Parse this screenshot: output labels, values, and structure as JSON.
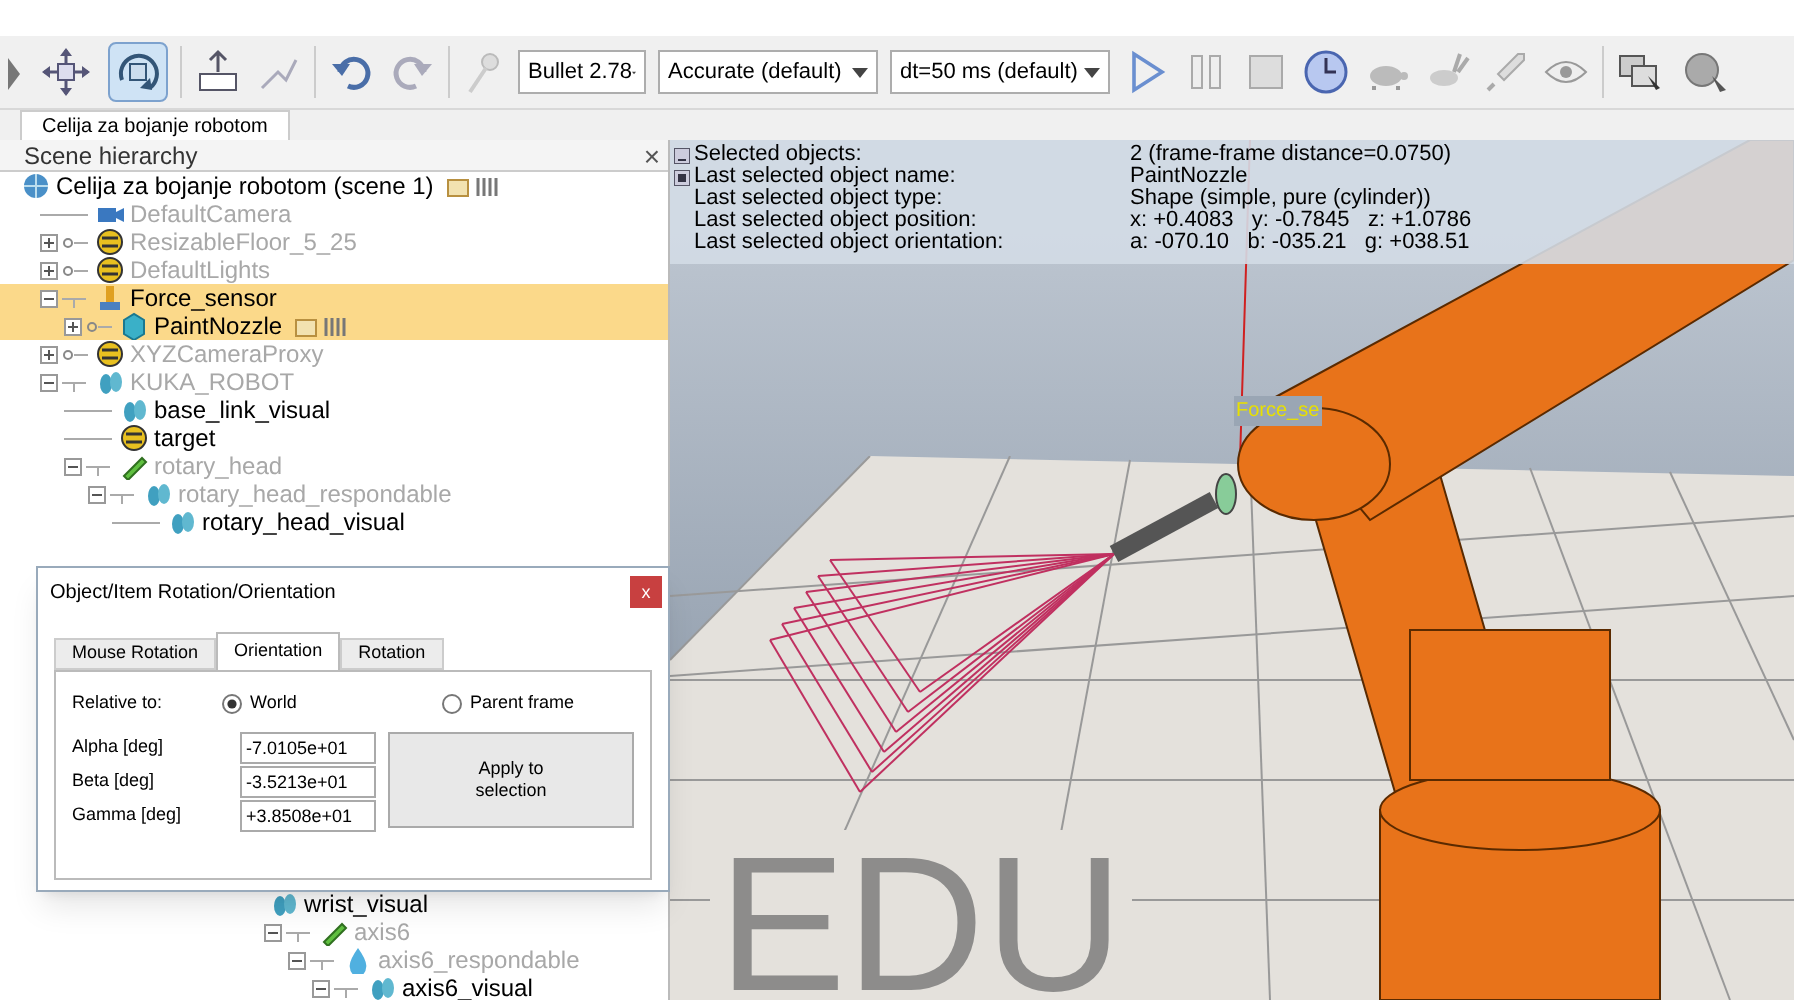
{
  "toolbar": {
    "mode_buttons": [
      {
        "kind": "move",
        "selected": false
      },
      {
        "kind": "rotate",
        "selected": true
      }
    ],
    "dropdowns": [
      {
        "value": "Bullet 2.78"
      },
      {
        "value": "Accurate (default)"
      },
      {
        "value": "dt=50 ms (default)"
      }
    ]
  },
  "scene_tabs": [
    {
      "label": "Celija za bojanje robotom",
      "selected": true
    }
  ],
  "hierarchy": {
    "title": "Scene hierarchy",
    "close": "×",
    "tree": [
      {
        "label": "Celija za bojanje robotom (scene 1)",
        "kind": "scene",
        "dim": false,
        "selected": false,
        "script": true,
        "children": [
          {
            "label": "DefaultCamera",
            "kind": "camera",
            "dim": true,
            "selected": false,
            "script": false
          },
          {
            "label": "ResizableFloor_5_25",
            "kind": "dummy",
            "dim": true,
            "selected": false,
            "script": false,
            "expanded": false
          },
          {
            "label": "DefaultLights",
            "kind": "dummy",
            "dim": true,
            "selected": false,
            "script": false,
            "expanded": false
          },
          {
            "label": "Force_sensor",
            "kind": "sensor",
            "dim": false,
            "selected": true,
            "script": false,
            "expanded": true,
            "children": [
              {
                "label": "PaintNozzle",
                "kind": "shape",
                "dim": false,
                "selected": true,
                "script": true,
                "expanded": false
              }
            ]
          },
          {
            "label": "XYZCameraProxy",
            "kind": "dummy",
            "dim": true,
            "selected": false,
            "script": false,
            "expanded": false
          },
          {
            "label": "KUKA_ROBOT",
            "kind": "mesh",
            "dim": true,
            "selected": false,
            "script": false,
            "expanded": true,
            "children": [
              {
                "label": "base_link_visual",
                "kind": "mesh",
                "dim": false,
                "selected": false,
                "script": false
              },
              {
                "label": "target",
                "kind": "dummy",
                "dim": false,
                "selected": false,
                "script": false
              },
              {
                "label": "rotary_head",
                "kind": "joint",
                "dim": true,
                "selected": false,
                "script": false,
                "expanded": true,
                "children": [
                  {
                    "label": "rotary_head_respondable",
                    "kind": "mesh",
                    "dim": true,
                    "selected": false,
                    "script": false,
                    "expanded": true,
                    "children": [
                      {
                        "label": "rotary_head_visual",
                        "kind": "mesh",
                        "dim": false,
                        "selected": false,
                        "script": false
                      }
                    ]
                  }
                ]
              }
            ]
          }
        ]
      }
    ],
    "tree_continued": [
      {
        "label": "wrist_visual",
        "kind": "mesh",
        "dim": false,
        "selected": false,
        "script": false
      },
      {
        "label": "axis6",
        "kind": "joint",
        "dim": true,
        "selected": false,
        "script": false,
        "expanded": true,
        "children": [
          {
            "label": "axis6_respondable",
            "kind": "drop",
            "dim": true,
            "selected": false,
            "script": false,
            "expanded": true,
            "children": [
              {
                "label": "axis6_visual",
                "kind": "mesh",
                "dim": false,
                "selected": false,
                "script": false,
                "expanded": true
              }
            ]
          }
        ]
      }
    ]
  },
  "info": [
    {
      "label": "Selected objects:",
      "value": "2 (frame-frame distance=0.0750)"
    },
    {
      "label": "Last selected object name:",
      "value": "PaintNozzle"
    },
    {
      "label": "Last selected object type:",
      "value": "Shape (simple, pure (cylinder))"
    },
    {
      "label": "Last selected object position:",
      "value": "x: +0.4083   y: -0.7845   z: +1.0786"
    },
    {
      "label": "Last selected object orientation:",
      "value": "a: -070.10   b: -035.21   g: +038.51"
    }
  ],
  "viewport": {
    "object_label": "Force_se",
    "edition": "EDU"
  },
  "dialog": {
    "title": "Object/Item Rotation/Orientation",
    "close": "x",
    "tabs": [
      {
        "label": "Mouse Rotation",
        "selected": false
      },
      {
        "label": "Orientation",
        "selected": true
      },
      {
        "label": "Rotation",
        "selected": false
      }
    ],
    "relative_label": "Relative to:",
    "radios": [
      {
        "label": "World",
        "selected": true
      },
      {
        "label": "Parent frame",
        "selected": false
      }
    ],
    "fields": [
      {
        "label": "Alpha [deg]",
        "value": "-7.0105e+01"
      },
      {
        "label": "Beta [deg]",
        "value": "-3.5213e+01"
      },
      {
        "label": "Gamma [deg]",
        "value": "+3.8508e+01"
      }
    ],
    "apply": "Apply to selection"
  }
}
